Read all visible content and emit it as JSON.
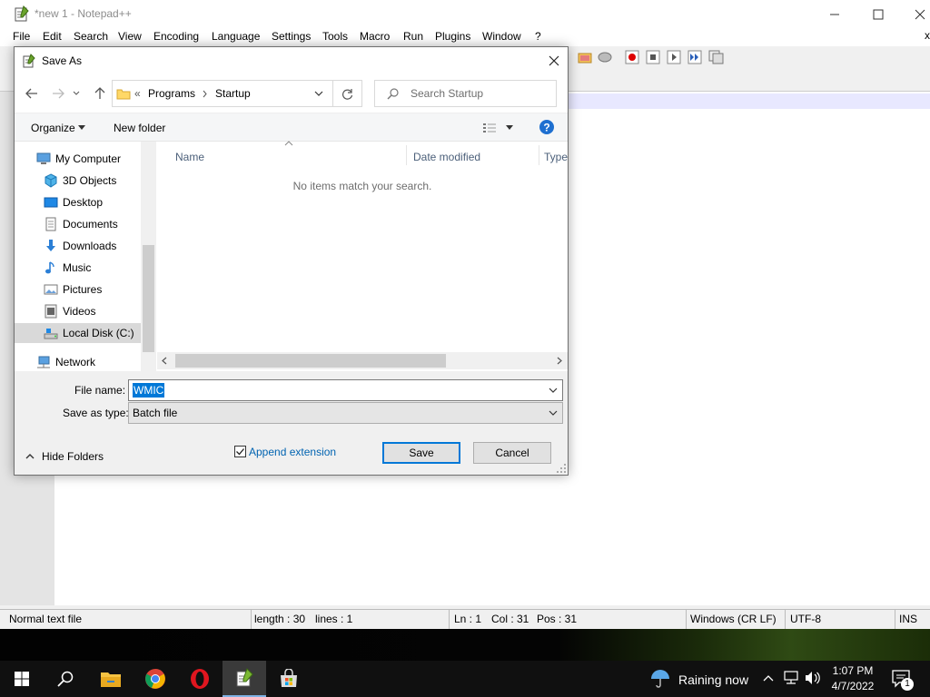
{
  "npp": {
    "title": "*new 1 - Notepad++",
    "menu": [
      "File",
      "Edit",
      "Search",
      "View",
      "Encoding",
      "Language",
      "Settings",
      "Tools",
      "Macro",
      "Run",
      "Plugins",
      "Window",
      "?"
    ],
    "status": {
      "file_type": "Normal text file",
      "length": "length : 30",
      "lines": "lines : 1",
      "ln": "Ln : 1",
      "col": "Col : 31",
      "pos": "Pos : 31",
      "eol": "Windows (CR LF)",
      "encoding": "UTF-8",
      "mode": "INS"
    }
  },
  "dialog": {
    "title": "Save As",
    "address": {
      "overflow": "«",
      "crumbs": [
        "Programs",
        "Startup"
      ]
    },
    "search_placeholder": "Search Startup",
    "organize": "Organize",
    "new_folder": "New folder",
    "tree": [
      {
        "label": "My Computer",
        "icon": "computer-icon",
        "top": true
      },
      {
        "label": "3D Objects",
        "icon": "3d-objects-icon"
      },
      {
        "label": "Desktop",
        "icon": "desktop-folder-icon"
      },
      {
        "label": "Documents",
        "icon": "documents-icon"
      },
      {
        "label": "Downloads",
        "icon": "downloads-icon"
      },
      {
        "label": "Music",
        "icon": "music-icon"
      },
      {
        "label": "Pictures",
        "icon": "pictures-icon"
      },
      {
        "label": "Videos",
        "icon": "videos-icon"
      },
      {
        "label": "Local Disk (C:)",
        "icon": "drive-icon",
        "selected": true
      },
      {
        "label": "Network",
        "icon": "network-icon",
        "top": true
      }
    ],
    "columns": [
      "Name",
      "Date modified",
      "Type"
    ],
    "empty_message": "No items match your search.",
    "file_name_label": "File name:",
    "file_name_value": "WMIC",
    "save_type_label": "Save as type:",
    "save_type_value": "Batch file",
    "hide_folders": "Hide Folders",
    "append_extension": "Append extension",
    "append_checked": true,
    "save": "Save",
    "cancel": "Cancel"
  },
  "taskbar": {
    "weather": "Raining now",
    "time": "1:07 PM",
    "date": "4/7/2022",
    "notification_count": "1"
  }
}
